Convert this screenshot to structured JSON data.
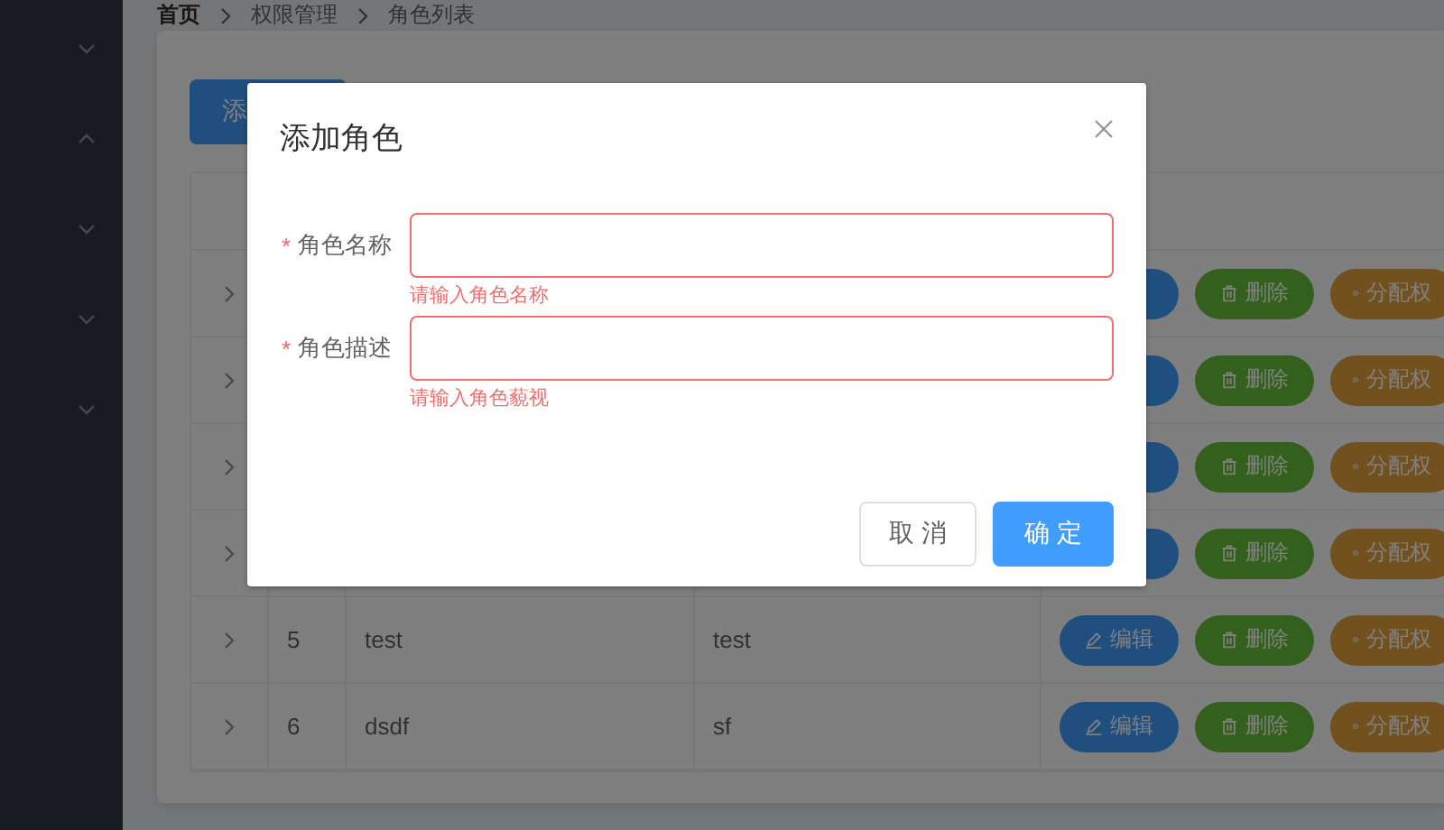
{
  "sidebar": {
    "items": [
      {
        "expanded": false
      },
      {
        "expanded": true
      },
      {
        "expanded": false
      },
      {
        "expanded": false
      },
      {
        "expanded": false
      }
    ]
  },
  "breadcrumb": [
    "首页",
    "权限管理",
    "角色列表"
  ],
  "add_button": {
    "label": "添"
  },
  "table": {
    "rows": [
      {
        "expanded": false,
        "actions": [
          {
            "kind": "edit"
          },
          {
            "kind": "delete",
            "label": "删除"
          },
          {
            "kind": "assign",
            "label": "分配权"
          }
        ]
      },
      {
        "expanded": false,
        "actions": [
          {
            "kind": "edit"
          },
          {
            "kind": "delete",
            "label": "删除"
          },
          {
            "kind": "assign",
            "label": "分配权"
          }
        ]
      },
      {
        "expanded": false,
        "actions": [
          {
            "kind": "edit"
          },
          {
            "kind": "delete",
            "label": "删除"
          },
          {
            "kind": "assign",
            "label": "分配权"
          }
        ]
      },
      {
        "expanded": false,
        "actions": [
          {
            "kind": "edit"
          },
          {
            "kind": "delete",
            "label": "删除"
          },
          {
            "kind": "assign",
            "label": "分配权"
          }
        ]
      },
      {
        "expanded": false,
        "index": "5",
        "name": "test",
        "description": "test",
        "actions": [
          {
            "kind": "edit",
            "label": "编辑"
          },
          {
            "kind": "delete",
            "label": "删除"
          },
          {
            "kind": "assign",
            "label": "分配权"
          }
        ]
      },
      {
        "expanded": false,
        "index": "6",
        "name": "dsdf",
        "description": "sf",
        "actions": [
          {
            "kind": "edit",
            "label": "编辑"
          },
          {
            "kind": "delete",
            "label": "删除"
          },
          {
            "kind": "assign",
            "label": "分配权"
          }
        ]
      }
    ]
  },
  "dialog": {
    "title": "添加角色",
    "fields": [
      {
        "label": "角色名称",
        "required_mark": "*",
        "error": "请输入角色名称"
      },
      {
        "label": "角色描述",
        "required_mark": "*",
        "error": "请输入角色藐视"
      }
    ],
    "buttons": [
      {
        "kind": "default",
        "label": "取消"
      },
      {
        "kind": "primary",
        "label": "确定"
      }
    ]
  }
}
